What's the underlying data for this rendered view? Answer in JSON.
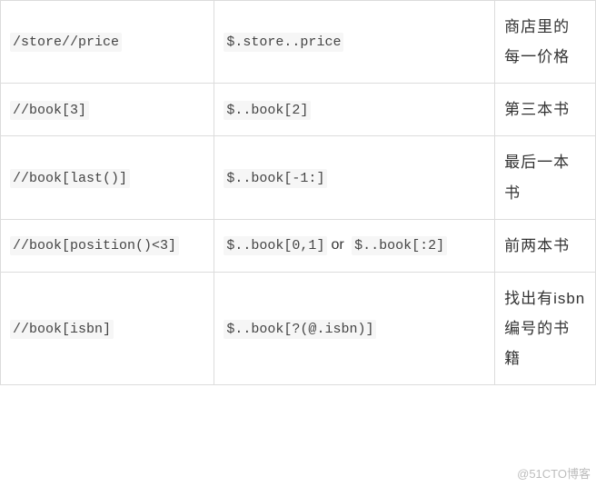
{
  "rows": [
    {
      "xpath": "/store//price",
      "jsonpath": "$.store..price",
      "jsonpath2": "",
      "connector": "",
      "desc": "商店里的每一价格"
    },
    {
      "xpath": "//book[3]",
      "jsonpath": "$..book[2]",
      "jsonpath2": "",
      "connector": "",
      "desc": "第三本书"
    },
    {
      "xpath": "//book[last()]",
      "jsonpath": "$..book[-1:]",
      "jsonpath2": "",
      "connector": "",
      "desc": "最后一本书"
    },
    {
      "xpath": "//book[position()<3]",
      "jsonpath": "$..book[0,1]",
      "jsonpath2": "$..book[:2]",
      "connector": "or",
      "desc": "前两本书"
    },
    {
      "xpath": "//book[isbn]",
      "jsonpath": "$..book[?(@.isbn)]",
      "jsonpath2": "",
      "connector": "",
      "desc": "找出有isbn编号的书籍"
    }
  ],
  "watermark": "@51CTO博客"
}
